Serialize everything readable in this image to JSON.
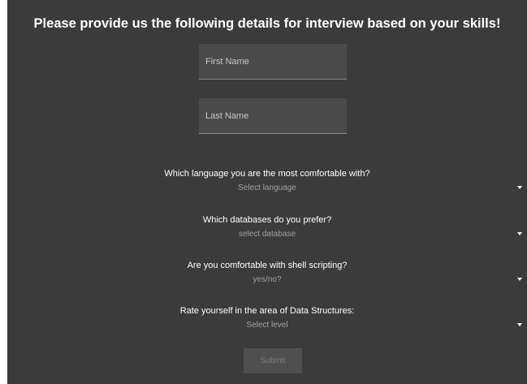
{
  "form": {
    "title": "Please provide us the following details for interview based on your skills!",
    "first_name": {
      "placeholder": "First Name",
      "value": ""
    },
    "last_name": {
      "placeholder": "Last Name",
      "value": ""
    },
    "questions": [
      {
        "label": "Which language you are the most comfortable with?",
        "selected": "Select language"
      },
      {
        "label": "Which databases do you prefer?",
        "selected": "select database"
      },
      {
        "label": "Are you comfortable with shell scripting?",
        "selected": "yes/no?"
      },
      {
        "label": "Rate yourself in the area of Data Structures:",
        "selected": "Select level"
      }
    ],
    "submit_label": "Submit"
  },
  "colors": {
    "panel_background": "#3b3b3b",
    "input_background": "#4a4a4a",
    "text_primary": "#ffffff",
    "text_muted": "#a3a3a3",
    "button_background": "#4f4f4f"
  },
  "icons": {
    "dropdown": "caret-down-icon"
  }
}
